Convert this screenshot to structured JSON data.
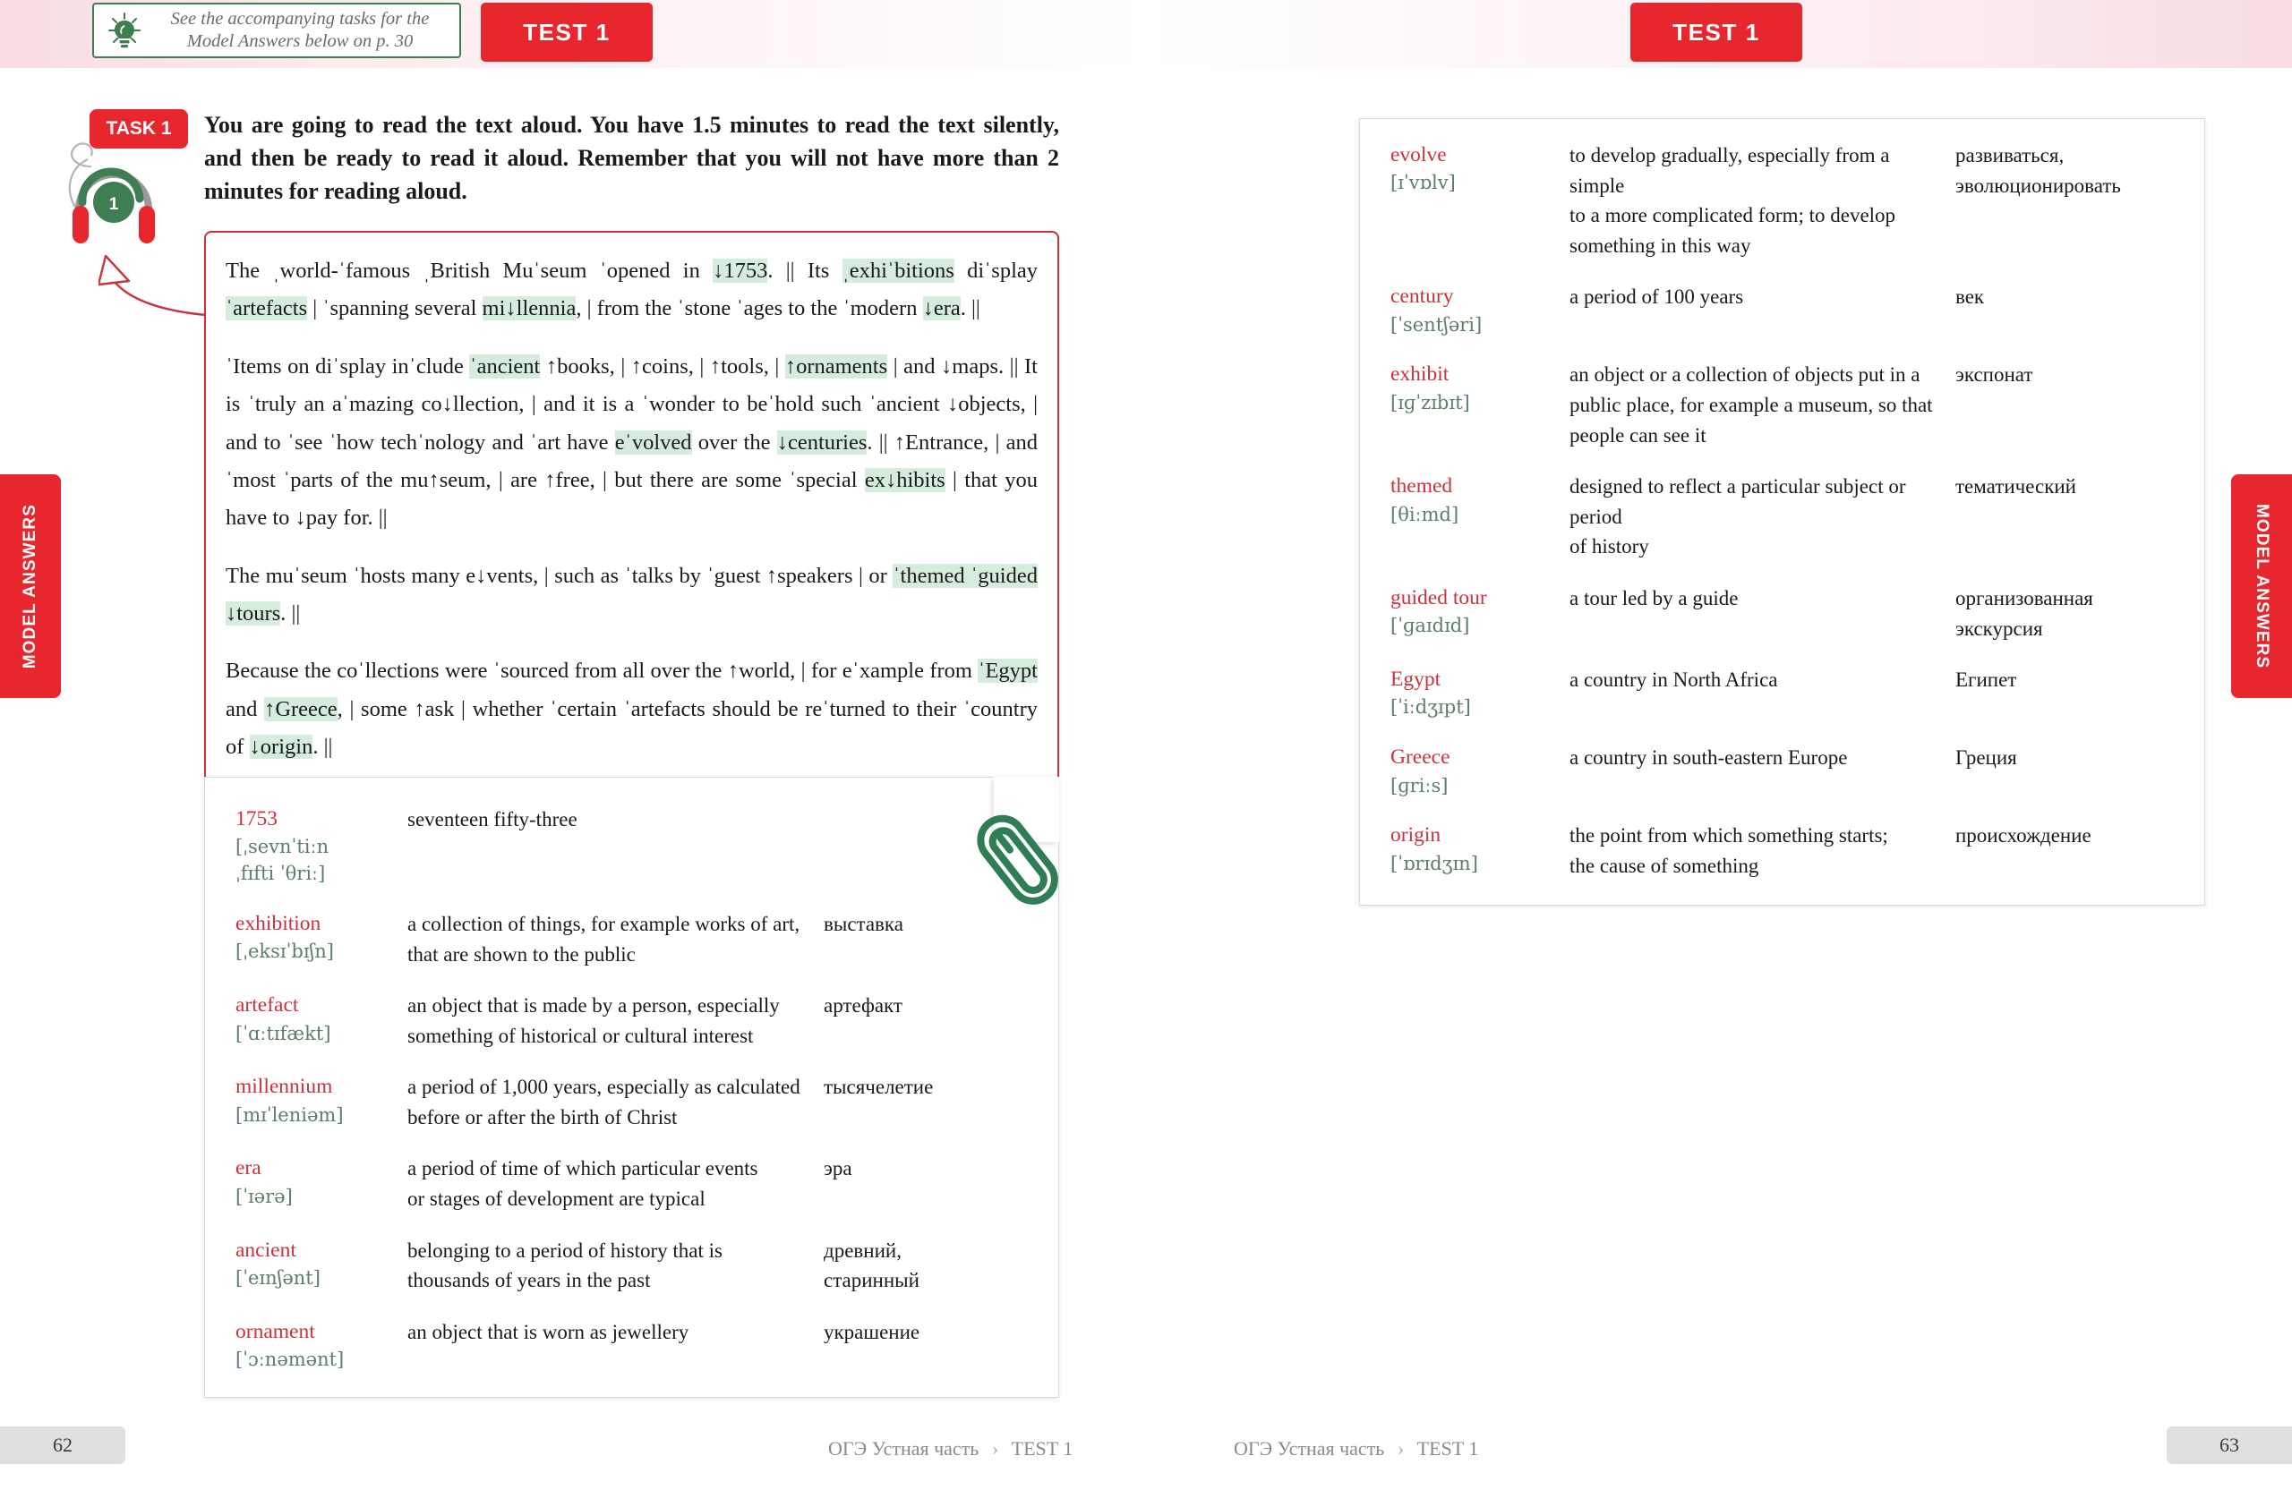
{
  "header": {
    "tip_note": "See the accompanying tasks for the\nModel Answers below on p. 30",
    "test_badge_left": "TEST 1",
    "test_badge_right": "TEST 1",
    "bulb_icon": "lightbulb-icon"
  },
  "side_tabs": {
    "left_label": "MODEL ANSWERS",
    "right_label": "MODEL ANSWERS"
  },
  "task": {
    "badge": "TASK 1",
    "number": "1",
    "instruction": "You are going to read the text aloud. You have 1.5 minutes to read the text silently, and then be ready to read it aloud. Remember that you will not have more than 2 minutes for reading aloud."
  },
  "reading_text": {
    "paragraphs": [
      "The ˌworld-ˈfamous ˌBritish Muˈseum ˈopened in ↓1753. || Its ˌexhiˈbitions diˈsplay ˈartefacts | ˈspanning several mi↓llennia, | from the ˈstone ˈages to the ˈmodern ↓era. ||",
      "ˈItems on diˈsplay inˈclude ˈancient ↑books, | ↑coins, | ↑tools, | ↑ornaments | and ↓maps. || It is ˈtruly an aˈmazing co↓llection, | and it is a ˈwonder to beˈhold such ˈancient ↓objects, | and to ˈsee ˈhow techˈnology and ˈart have eˈvolved over the ↓centuries. || ↑Entrance, | and ˈmost ˈparts of the mu↑seum, | are ↑free, | but there are some ˈspecial ex↓hibits | that you have to ↓pay for. ||",
      "The muˈseum ˈhosts many e↓vents, | such as ˈtalks by ˈguest ↑speakers | or ˈthemed ˈguided ↓tours. ||",
      "Because the coˈllections were ˈsourced from all over the ↑world, | for eˈxample from ˈEgypt and ↑Greece, | some ↑ask | whether ˈcertain ˈartefacts should be reˈturned to their ˈcountry of ↓origin. ||"
    ]
  },
  "glossary_left": {
    "paperclip_icon": "paperclip-icon",
    "entries": [
      {
        "word": "1753",
        "ipa": "[ˌsevnˈtiːn\nˌfɪfti ˈθriː]",
        "definition": "seventeen fifty-three",
        "russian": ""
      },
      {
        "word": "exhibition",
        "ipa": "[ˌeksɪˈbɪʃn]",
        "definition": "a collection of things, for example works of art,\nthat are shown to the public",
        "russian": "выставка"
      },
      {
        "word": "artefact",
        "ipa": "[ˈɑːtɪfækt]",
        "definition": "an object that is made by a person, especially\nsomething of historical or cultural interest",
        "russian": "артефакт"
      },
      {
        "word": "millennium",
        "ipa": "[mɪˈleniəm]",
        "definition": "a period of 1,000 years, especially as calculated\nbefore or after the birth of Christ",
        "russian": "тысячелетие"
      },
      {
        "word": "era",
        "ipa": "[ˈɪərə]",
        "definition": "a period of time of which particular events\nor stages of development are typical",
        "russian": "эра"
      },
      {
        "word": "ancient",
        "ipa": "[ˈeɪnʃənt]",
        "definition": "belonging to a period of history that is\nthousands of years in the past",
        "russian": "древний,\nстаринный"
      },
      {
        "word": "ornament",
        "ipa": "[ˈɔːnəmənt]",
        "definition": "an object that is worn as jewellery",
        "russian": "украшение"
      }
    ]
  },
  "glossary_right": {
    "entries": [
      {
        "word": "evolve",
        "ipa": "[ɪˈvɒlv]",
        "definition": "to develop gradually, especially from a simple\nto a more complicated form; to develop\nsomething in this way",
        "russian": "развиваться,\nэволюционировать"
      },
      {
        "word": "century",
        "ipa": "[ˈsentʃəri]",
        "definition": "a period of 100 years",
        "russian": "век"
      },
      {
        "word": "exhibit",
        "ipa": "[ɪɡˈzɪbɪt]",
        "definition": "an object or a collection of objects put in a\npublic place, for example a museum, so that\npeople can see it",
        "russian": "экспонат"
      },
      {
        "word": "themed",
        "ipa": "[θiːmd]",
        "definition": "designed to reflect a particular subject or\nperiod\nof history",
        "russian": "тематический"
      },
      {
        "word": "guided tour",
        "ipa": "[ˈɡaɪdɪd]",
        "definition": "a tour led by a guide",
        "russian": "организованная\nэкскурсия"
      },
      {
        "word": "Egypt",
        "ipa": "[ˈiːdʒɪpt]",
        "definition": "a country in North Africa",
        "russian": "Египет"
      },
      {
        "word": "Greece",
        "ipa": "[ɡriːs]",
        "definition": "a country in south-eastern Europe",
        "russian": "Греция"
      },
      {
        "word": "origin",
        "ipa": "[ˈɒrɪdʒɪn]",
        "definition": "the point from which something starts;\nthe cause of something",
        "russian": "происхождение"
      }
    ]
  },
  "footer": {
    "page_left": "62",
    "page_right": "63",
    "breadcrumb_section": "ОГЭ Устная часть",
    "breadcrumb_separator": "›",
    "breadcrumb_test": "TEST 1"
  },
  "colors": {
    "accent_red": "#e8262d",
    "word_red": "#c8333c",
    "ipa_green": "#5c7f68",
    "highlight_green": "#d6ecdc",
    "band_pink": "#f8dde2"
  }
}
